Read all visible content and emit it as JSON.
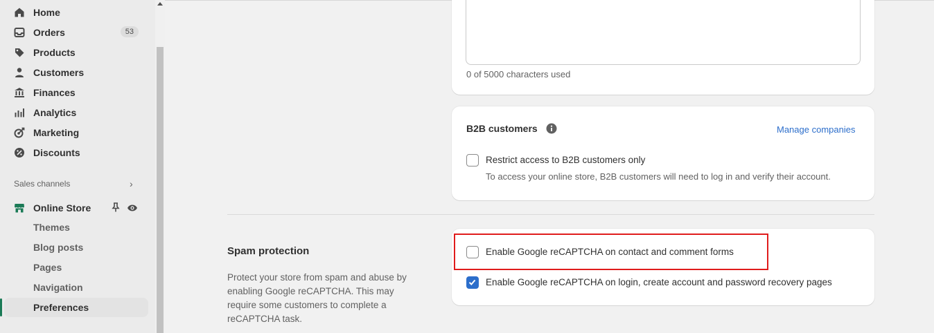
{
  "sidebar": {
    "items": [
      {
        "label": "Home",
        "icon": "home-icon"
      },
      {
        "label": "Orders",
        "icon": "orders-icon",
        "badge": "53"
      },
      {
        "label": "Products",
        "icon": "tag-icon"
      },
      {
        "label": "Customers",
        "icon": "person-icon"
      },
      {
        "label": "Finances",
        "icon": "bank-icon"
      },
      {
        "label": "Analytics",
        "icon": "bar-chart-icon"
      },
      {
        "label": "Marketing",
        "icon": "target-icon"
      },
      {
        "label": "Discounts",
        "icon": "discount-icon"
      }
    ],
    "sales_channels_label": "Sales channels",
    "online_store": {
      "label": "Online Store",
      "sub_items": [
        "Themes",
        "Blog posts",
        "Pages",
        "Navigation",
        "Preferences"
      ],
      "active": "Preferences"
    }
  },
  "main": {
    "char_count": "0 of 5000 characters used",
    "b2b": {
      "title": "B2B customers",
      "manage_link": "Manage companies",
      "checkbox_label": "Restrict access to B2B customers only",
      "checkbox_checked": false,
      "help_text": "To access your online store, B2B customers will need to log in and verify their account."
    },
    "spam": {
      "title": "Spam protection",
      "description": "Protect your store from spam and abuse by enabling Google reCAPTCHA. This may require some customers to complete a reCAPTCHA task.",
      "options": [
        {
          "label": "Enable Google reCAPTCHA on contact and comment forms",
          "checked": false
        },
        {
          "label": "Enable Google reCAPTCHA on login, create account and password recovery pages",
          "checked": true
        }
      ]
    }
  },
  "colors": {
    "accent": "#2c6ecb",
    "active_bar": "#1a7a56",
    "highlight": "#e01b1b"
  }
}
